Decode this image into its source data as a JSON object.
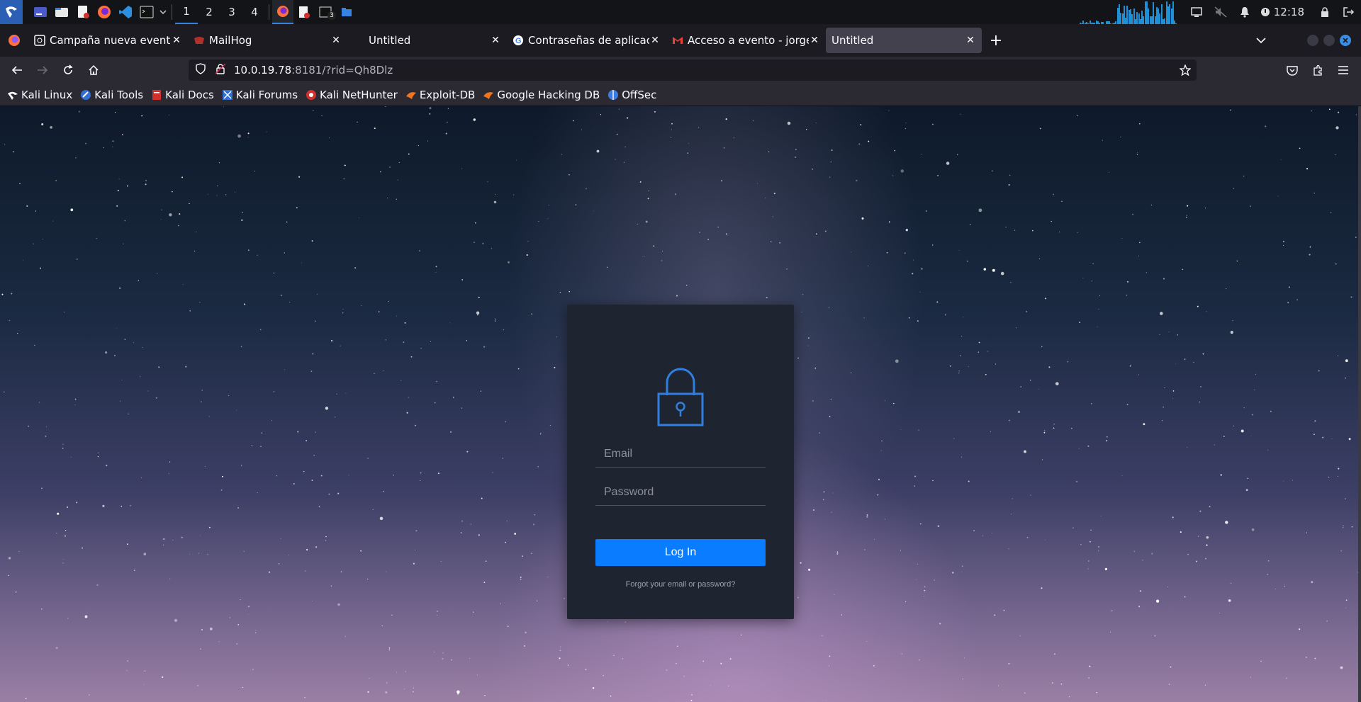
{
  "taskbar": {
    "workspaces": [
      "1",
      "2",
      "3",
      "4"
    ],
    "clock": "12:18",
    "terminal_badge": "3"
  },
  "browser": {
    "tabs": [
      {
        "title": "Campaña nueva evento -",
        "icon": "globe-icon"
      },
      {
        "title": "MailHog",
        "icon": "mailhog-icon"
      },
      {
        "title": "Untitled",
        "icon": ""
      },
      {
        "title": "Contraseñas de aplicación",
        "icon": "google-icon"
      },
      {
        "title": "Acceso a evento - jorgees",
        "icon": "gmail-icon"
      },
      {
        "title": "Untitled",
        "icon": ""
      }
    ],
    "url_host": "10.0.19.78",
    "url_rest": ":8181/?rid=Qh8Dlz",
    "bookmarks": [
      "Kali Linux",
      "Kali Tools",
      "Kali Docs",
      "Kali Forums",
      "Kali NetHunter",
      "Exploit-DB",
      "Google Hacking DB",
      "OffSec"
    ]
  },
  "login": {
    "email_placeholder": "Email",
    "password_placeholder": "Password",
    "button_label": "Log In",
    "forgot_link": "Forgot your email or password?"
  },
  "colors": {
    "accent": "#0a7cff",
    "lock_icon": "#2f7ee0",
    "card_bg": "#1f2530"
  }
}
